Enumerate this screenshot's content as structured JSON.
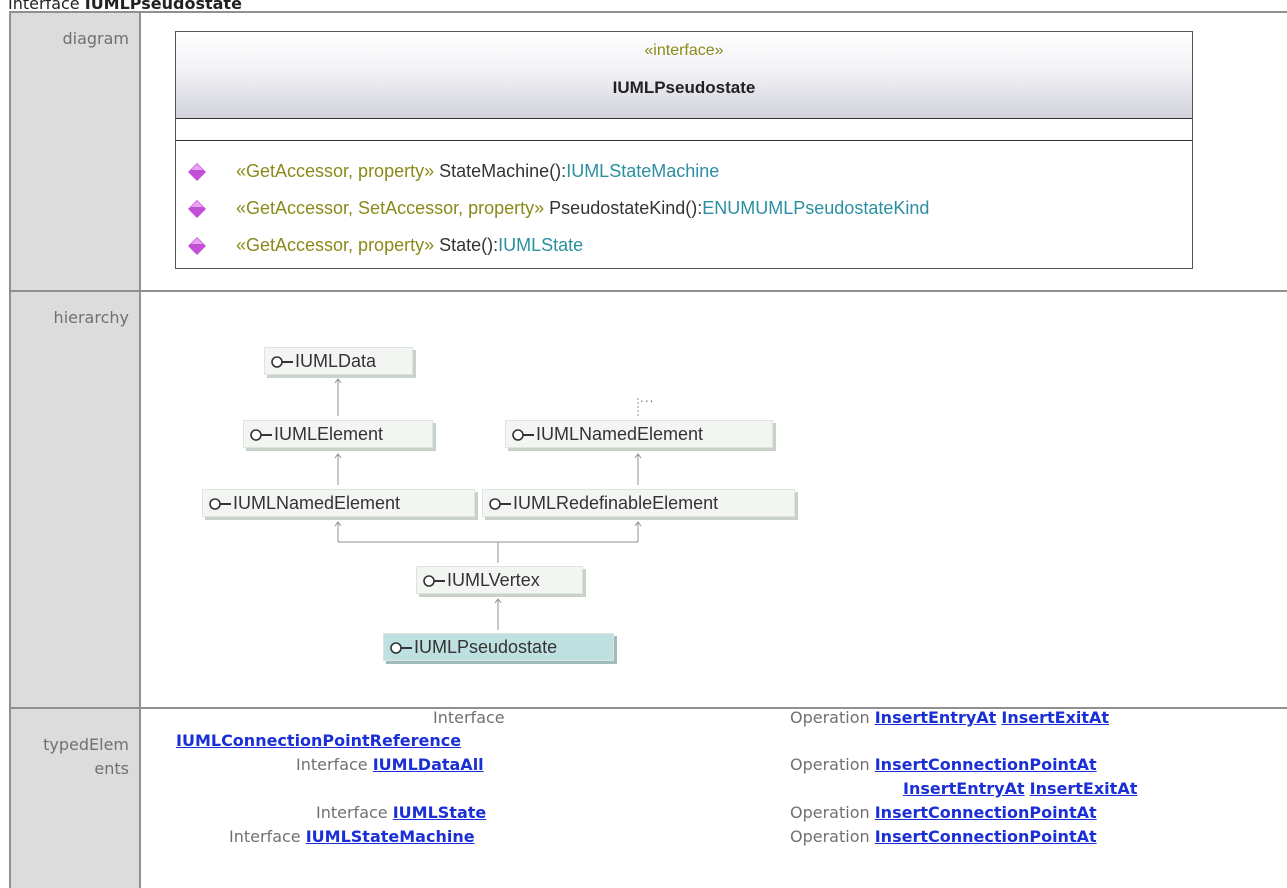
{
  "page": {
    "kind": "Interface",
    "name": "IUMLPseudostate"
  },
  "rows": {
    "diagram": "diagram",
    "hierarchy": "hierarchy",
    "typed_line1": "typedElem",
    "typed_line2": "ents"
  },
  "class_box": {
    "stereotype": "«interface»",
    "name": "IUMLPseudostate",
    "operations": [
      {
        "stereo": "«GetAccessor, property»",
        "name": "StateMachine():",
        "type": "IUMLStateMachine"
      },
      {
        "stereo": "«GetAccessor, SetAccessor, property»",
        "name": "PseudostateKind():",
        "type": "ENUMUMLPseudostateKind"
      },
      {
        "stereo": "«GetAccessor, property»",
        "name": "State():",
        "type": "IUMLState"
      }
    ]
  },
  "hierarchy": {
    "nodes": [
      "IUMLData",
      "IUMLElement",
      "IUMLNamedElement",
      "IUMLNamedElement",
      "IUMLRedefinableElement",
      "IUMLVertex",
      "IUMLPseudostate"
    ],
    "more": "..."
  },
  "typed_elements": {
    "left": [
      {
        "kind": "Interface",
        "link": ""
      },
      {
        "kind": "",
        "link": "IUMLConnectionPointReference"
      },
      {
        "kind": "Interface ",
        "link": "IUMLDataAll"
      },
      {
        "kind": "Interface ",
        "link": "IUMLState"
      },
      {
        "kind": "Interface ",
        "link": "IUMLStateMachine"
      }
    ],
    "right": [
      {
        "kind": "Operation ",
        "links": [
          "InsertEntryAt",
          "InsertExitAt"
        ]
      },
      {
        "kind": "Operation ",
        "links": [
          "InsertConnectionPointAt"
        ]
      },
      {
        "kind": "",
        "links": [
          "InsertEntryAt",
          "InsertExitAt"
        ]
      },
      {
        "kind": "Operation ",
        "links": [
          "InsertConnectionPointAt"
        ]
      },
      {
        "kind": "Operation ",
        "links": [
          "InsertConnectionPointAt"
        ]
      }
    ]
  },
  "colors": {
    "stereotype": "#8a8a1a",
    "type_link": "#2a8fa0",
    "link": "#1a2fd6",
    "diamond": "#c24fd6"
  }
}
